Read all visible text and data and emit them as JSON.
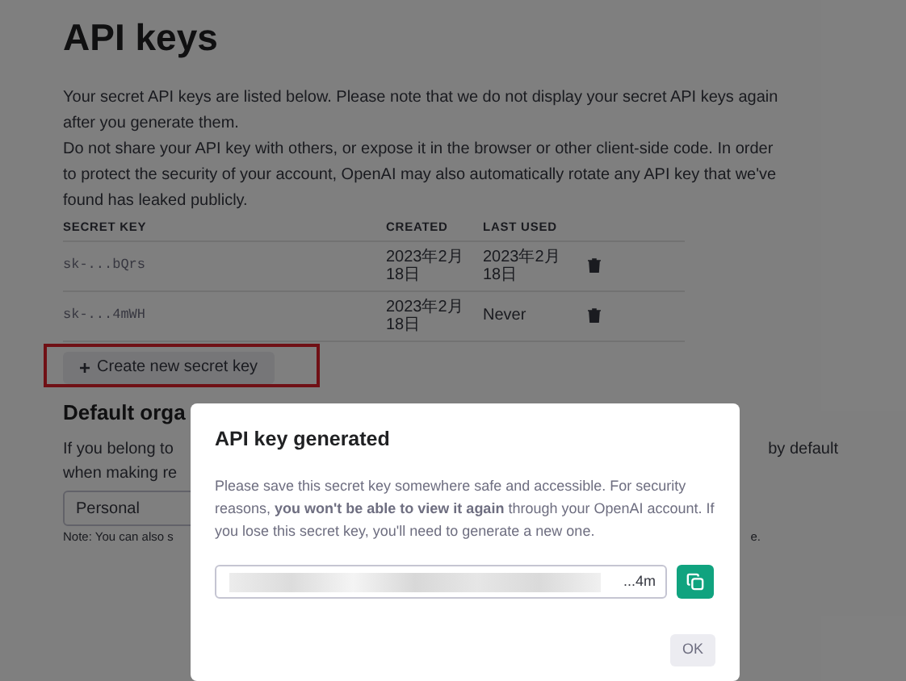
{
  "page": {
    "title": "API keys",
    "intro": [
      "Your secret API keys are listed below. Please note that we do not display your secret API keys again after you generate them.",
      "Do not share your API key with others, or expose it in the browser or other client-side code. In order to protect the security of your account, OpenAI may also automatically rotate any API key that we've found has leaked publicly."
    ],
    "table": {
      "columns": [
        "SECRET KEY",
        "CREATED",
        "LAST USED"
      ],
      "rows": [
        {
          "key": "sk-...bQrs",
          "created": "2023年2月18日",
          "last_used": "2023年2月18日"
        },
        {
          "key": "sk-...4mWH",
          "created": "2023年2月18日",
          "last_used": "Never"
        }
      ]
    },
    "create_button": {
      "icon": "+",
      "label": "Create new secret key",
      "highlighted": true
    },
    "default_org": {
      "heading": "Default orga",
      "text_left": [
        "If you belong to",
        "when making re"
      ],
      "text_right": "by default",
      "select_value": "Personal",
      "note_left": "Note: You can also s",
      "note_right": "e."
    }
  },
  "dialog": {
    "title": "API key generated",
    "text": "Please save this secret key somewhere safe and accessible. For security reasons, **you won't be able to view it again** through your OpenAI account. If you lose this secret key, you'll need to generate a new one.",
    "key_value": "...4m",
    "ok_button": "OK"
  }
}
